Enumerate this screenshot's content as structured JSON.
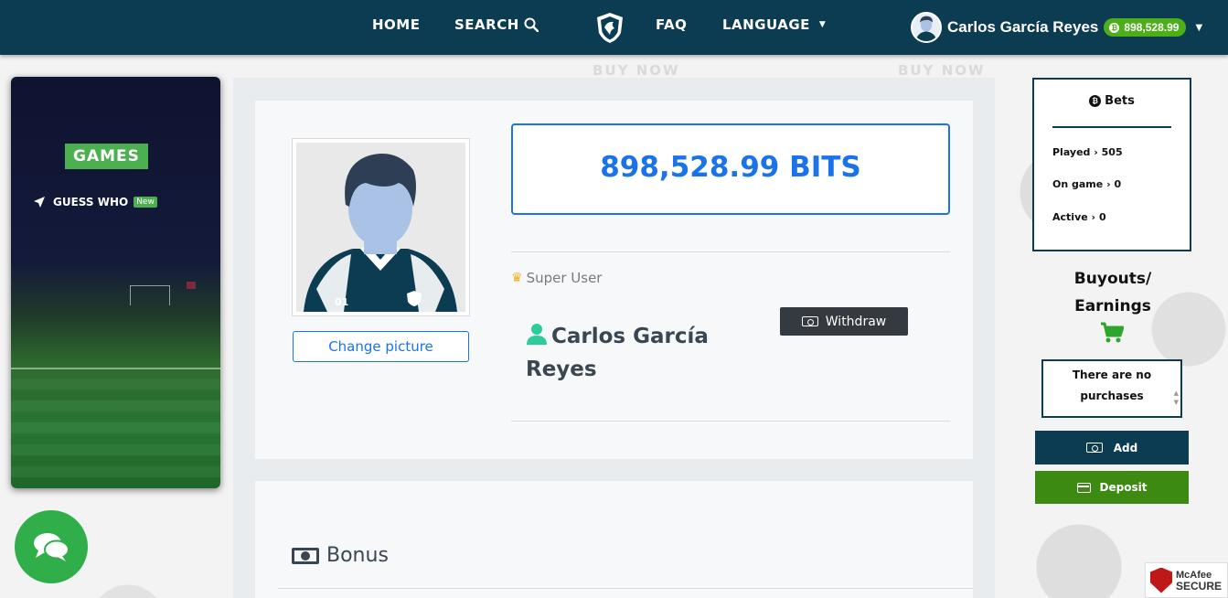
{
  "nav": {
    "home": "HOME",
    "search": "SEARCH",
    "faq": "FAQ",
    "language": "LANGUAGE",
    "user_name": "Carlos García Reyes",
    "balance": "898,528.99",
    "icons": [
      "search-icon",
      "shield-logo-icon",
      "caret-down-icon",
      "bitcoin-icon"
    ]
  },
  "background": {
    "text1": "BUY NOW",
    "text2": "BUY NOW"
  },
  "games": {
    "badge": "GAMES",
    "item_label": "GUESS WHO",
    "item_tag": "New"
  },
  "profile": {
    "bits": "898,528.99 BITS",
    "role": "Super User",
    "name": "Carlos García Reyes",
    "change_picture": "Change picture",
    "withdraw": "Withdraw",
    "jersey_number": "01"
  },
  "bonus": {
    "title": "Bonus"
  },
  "stats": {
    "bets_title": "Bets",
    "played_label": "Played",
    "played_value": "505",
    "on_game_label": "On game",
    "on_game_value": "0",
    "active_label": "Active",
    "active_value": "0",
    "buyouts_line1": "Buyouts/",
    "buyouts_line2": "Earnings",
    "no_purchases_line1": "There are no",
    "no_purchases_line2": "purchases",
    "add": "Add",
    "deposit": "Deposit"
  },
  "badge": {
    "line1": "McAfee",
    "line2": "SECURE"
  },
  "colors": {
    "navbar": "#0b3c51",
    "accent_blue": "#1a73e8",
    "green": "#4caf50",
    "deposit_green": "#3d8a12",
    "dark_button": "#343a40"
  }
}
